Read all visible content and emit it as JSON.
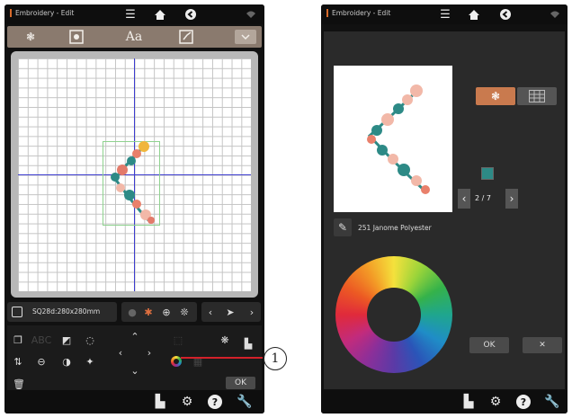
{
  "left_screen": {
    "title": "Embroidery - Edit",
    "hoop_label": "SQ28d:280x280mm",
    "ok_label": "OK"
  },
  "right_screen": {
    "title": "Embroidery - Edit",
    "page_indicator": "2 / 7",
    "thread_label": "251 Janome Polyester",
    "ok_label": "OK",
    "cancel_label": "✕"
  },
  "callout": {
    "number": "1"
  },
  "icons": {
    "menu": "☰",
    "home": "⌂",
    "back": "◀",
    "wifi": "wifi-icon",
    "font": "Aa",
    "settings": "⚙",
    "help": "?",
    "wrench": "⚒"
  },
  "colors": {
    "toolbar": "#8a7a6e",
    "accent": "#d76a2b",
    "grid_axis": "#3c3ccf",
    "hoop": "#8fd28f",
    "callout_line": "#d3212a",
    "swatch": "#2d8a86"
  }
}
